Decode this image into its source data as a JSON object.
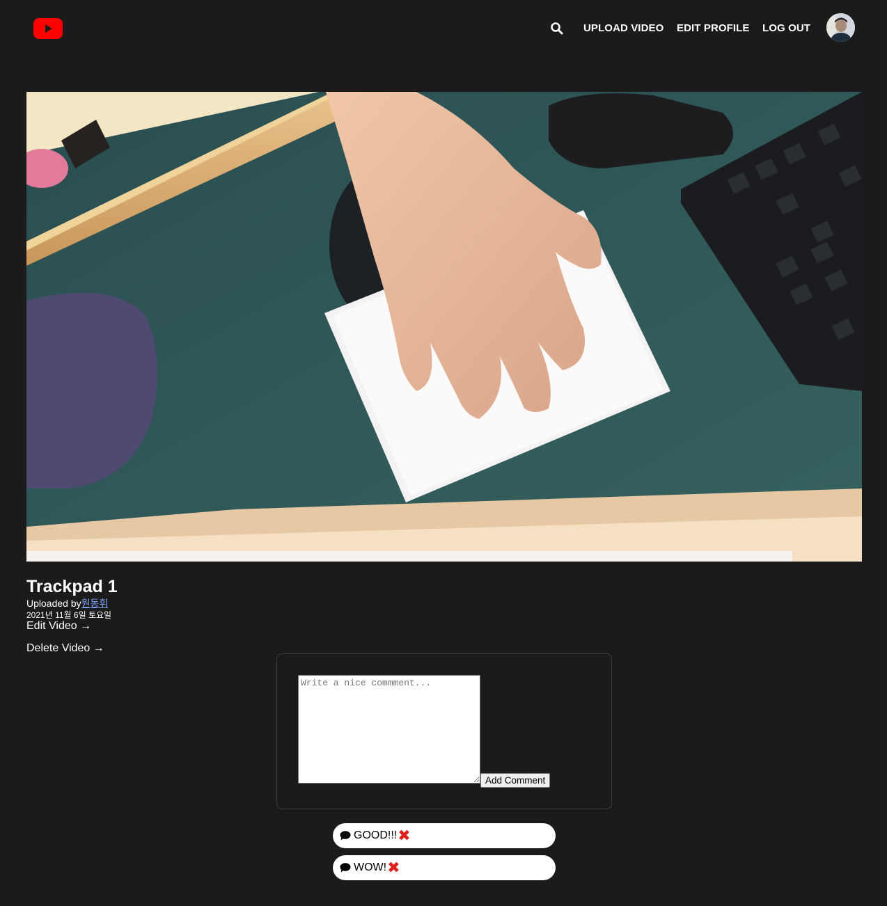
{
  "header": {
    "logo_icon": "youtube-logo-icon",
    "search_icon": "search-icon",
    "nav": {
      "upload_label": "UPLOAD VIDEO",
      "edit_profile_label": "EDIT PROFILE",
      "logout_label": "LOG OUT"
    },
    "avatar_icon": "user-avatar"
  },
  "video": {
    "title": "Trackpad 1",
    "uploaded_prefix": "Uploaded by",
    "uploader": "원동휘",
    "date": "2021년 11월 6일 토요일",
    "edit_label": "Edit Video →",
    "delete_label": "Delete Video →"
  },
  "comment_form": {
    "placeholder": "Write a nice commment...",
    "value": "",
    "submit_label": "Add Comment"
  },
  "comments": [
    {
      "text": "GOOD!!!",
      "delete_symbol": "✖"
    },
    {
      "text": "WOW!",
      "delete_symbol": "✖"
    }
  ],
  "colors": {
    "background": "#1b1b1b",
    "brand_red": "#ff0000",
    "link_blue": "#7ea6ff",
    "delete_red": "#e0201f"
  }
}
